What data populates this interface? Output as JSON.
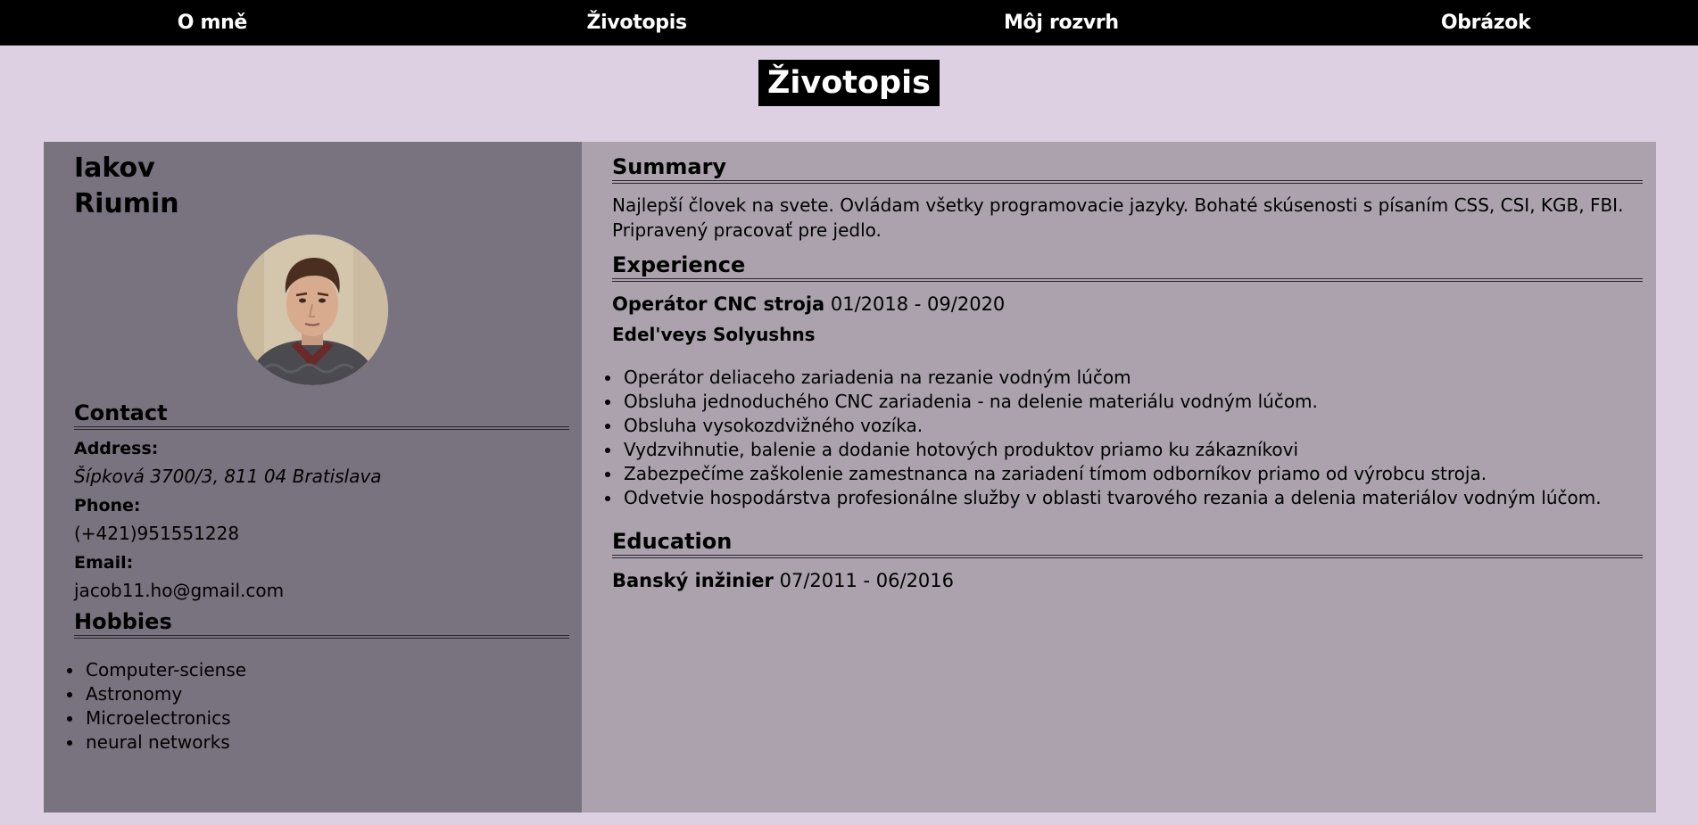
{
  "nav": {
    "items": [
      {
        "label": "O mně"
      },
      {
        "label": "Životopis"
      },
      {
        "label": "Môj rozvrh"
      },
      {
        "label": "Obrázok"
      }
    ]
  },
  "page_title": "Životopis",
  "person": {
    "first_name": "Iakov",
    "last_name": "Riumin"
  },
  "contact": {
    "title": "Contact",
    "address_label": "Address:",
    "address": "Šípková 3700/3, 811 04 Bratislava",
    "phone_label": "Phone:",
    "phone": "(+421)951551228",
    "email_label": "Email:",
    "email": "jacob11.ho@gmail.com"
  },
  "hobbies": {
    "title": "Hobbies",
    "items": [
      "Computer-sciense",
      "Astronomy",
      "Microelectronics",
      "neural networks"
    ]
  },
  "summary": {
    "title": "Summary",
    "text": "Najlepší človek na svete. Ovládam všetky programovacie jazyky. Bohaté skúsenosti s písaním CSS, CSI, KGB, FBI. Pripravený pracovať pre jedlo."
  },
  "experience": {
    "title": "Experience",
    "job_title": "Operátor CNC stroja",
    "job_dates": " 01/2018 - 09/2020",
    "company": "Edel'veys Solyushns",
    "duties": [
      "Operátor deliaceho zariadenia na rezanie vodným lúčom",
      "Obsluha jednoduchého CNC zariadenia - na delenie materiálu vodným lúčom.",
      "Obsluha vysokozdvižného vozíka.",
      "Vydzvihnutie, balenie a dodanie hotových produktov priamo ku zákazníkovi",
      "Zabezpečíme zaškolenie zamestnanca na zariadení tímom odborníkov priamo od výrobcu stroja.",
      "Odvetvie hospodárstva profesionálne služby v oblasti tvarového rezania a delenia materiálov vodným lúčom."
    ]
  },
  "education": {
    "title": "Education",
    "degree": "Banský inžinier",
    "dates": " 07/2011 - 06/2016"
  }
}
